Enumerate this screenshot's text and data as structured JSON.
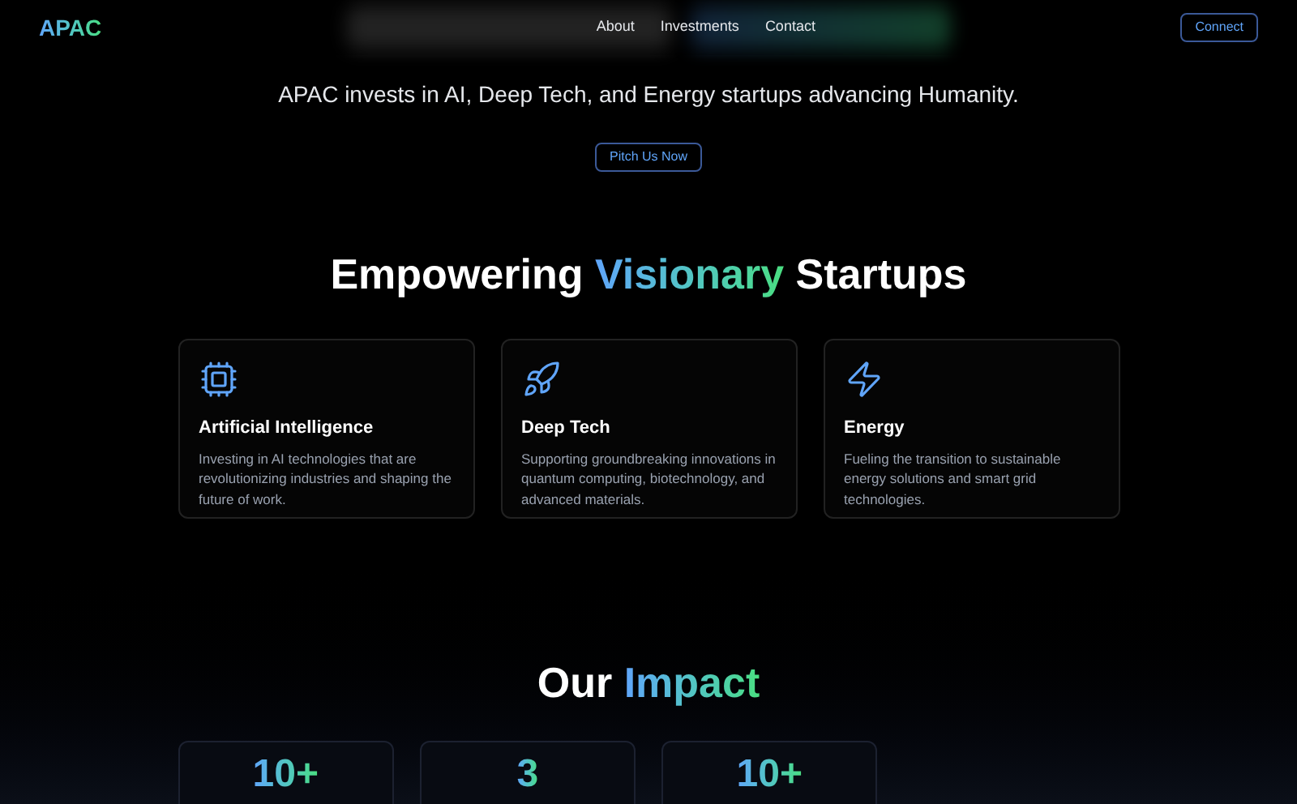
{
  "nav": {
    "logo": "APAC",
    "links": [
      "About",
      "Investments",
      "Contact"
    ],
    "button": "Connect"
  },
  "hero": {
    "subtitle": "APAC invests in AI, Deep Tech, and Energy startups advancing Humanity.",
    "button": "Pitch Us Now"
  },
  "focus": {
    "heading_before": "Empowering",
    "heading_accent": "Visionary",
    "heading_after": "Startups",
    "cards": [
      {
        "kind": "chip",
        "title": "Artificial Intelligence",
        "text": "Investing in AI technologies that are revolutionizing industries and shaping the future of work."
      },
      {
        "kind": "rocket",
        "title": "Deep Tech",
        "text": "Supporting groundbreaking innovations in quantum computing, biotechnology, and advanced materials."
      },
      {
        "kind": "bolt",
        "title": "Energy",
        "text": "Fueling the transition to sustainable energy solutions and smart grid technologies."
      }
    ]
  },
  "impact": {
    "heading_plain": "Our",
    "heading_accent": "Impact",
    "stats": [
      "10+",
      "3",
      "10+"
    ]
  }
}
